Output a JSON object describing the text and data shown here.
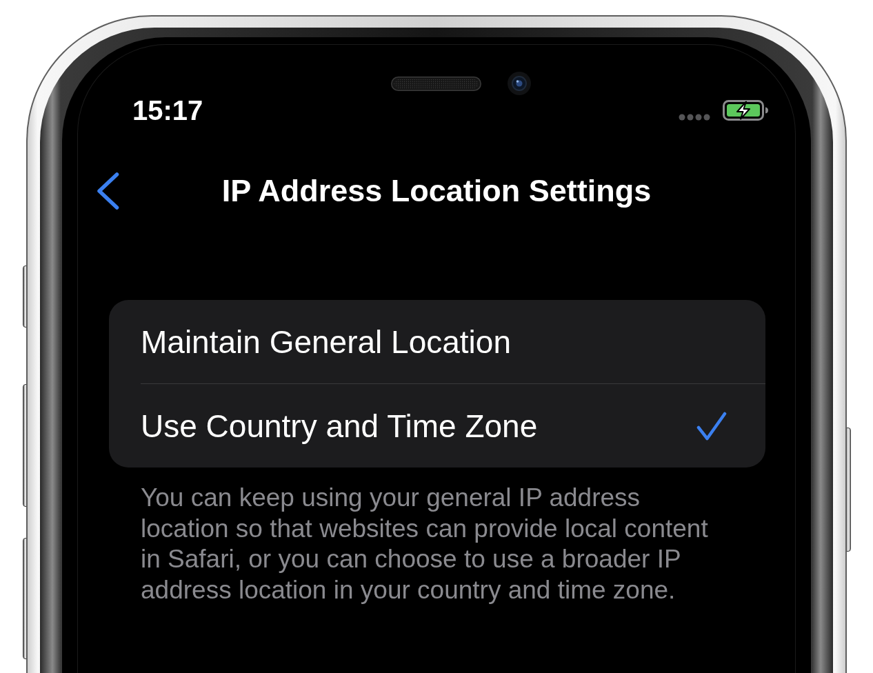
{
  "status_bar": {
    "time": "15:17"
  },
  "nav_bar": {
    "title": "IP Address Location Settings"
  },
  "options": [
    {
      "label": "Maintain General Location",
      "selected": false
    },
    {
      "label": "Use Country and Time Zone",
      "selected": true
    }
  ],
  "footer": "You can keep using your general IP address location so that websites can provide local content in Safari, or you can choose to use a broader IP address location in your country and time zone."
}
